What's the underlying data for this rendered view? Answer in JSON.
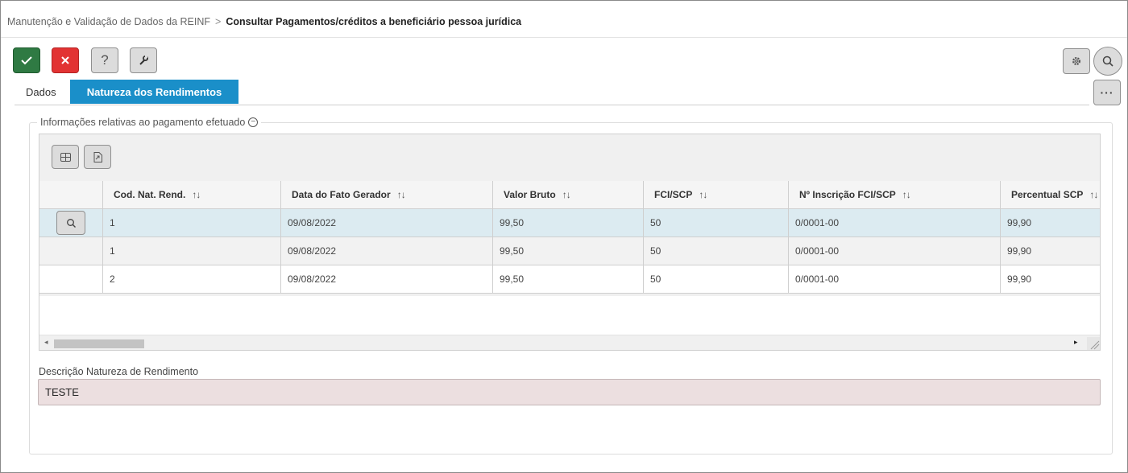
{
  "breadcrumb": {
    "parent": "Manutenção e Validação de Dados da REINF",
    "separator": ">",
    "current": "Consultar Pagamentos/créditos a beneficiário pessoa jurídica"
  },
  "toolbar": {
    "confirm_icon": "check-icon",
    "cancel_icon": "close-icon",
    "help_label": "?",
    "tools_icon": "wrench-icon",
    "settings_icon": "gear-icon",
    "search_icon": "search-icon",
    "more_label": "···"
  },
  "tabs": [
    {
      "label": "Dados",
      "active": false
    },
    {
      "label": "Natureza dos Rendimentos",
      "active": true
    }
  ],
  "section": {
    "legend": "Informações relativas ao pagamento efetuado",
    "collapse_symbol": "−"
  },
  "grid": {
    "columns": [
      {
        "label": "Cod. Nat. Rend.",
        "sort": "↑↓"
      },
      {
        "label": "Data do Fato Gerador",
        "sort": "↑↓"
      },
      {
        "label": "Valor Bruto",
        "sort": "↑↓"
      },
      {
        "label": "FCI/SCP",
        "sort": "↑↓"
      },
      {
        "label": "Nº Inscrição FCI/SCP",
        "sort": "↑↓"
      },
      {
        "label": "Percentual SCP",
        "sort": "↑↓"
      }
    ],
    "rows": [
      [
        "1",
        "09/08/2022",
        "99,50",
        "50",
        "0/0001-00",
        "99,90"
      ],
      [
        "1",
        "09/08/2022",
        "99,50",
        "50",
        "0/0001-00",
        "99,90"
      ],
      [
        "2",
        "09/08/2022",
        "99,50",
        "50",
        "0/0001-00",
        "99,90"
      ]
    ],
    "selected_row": 0,
    "scroll_left": "◂",
    "scroll_right": "▸"
  },
  "description": {
    "label": "Descrição Natureza de Rendimento",
    "value": "TESTE"
  },
  "colors": {
    "accent_tab": "#1a8fc9",
    "confirm": "#2f7a43",
    "cancel": "#e23333",
    "selected_row": "#dcebf1",
    "readonly_field": "#ecdfe0"
  }
}
